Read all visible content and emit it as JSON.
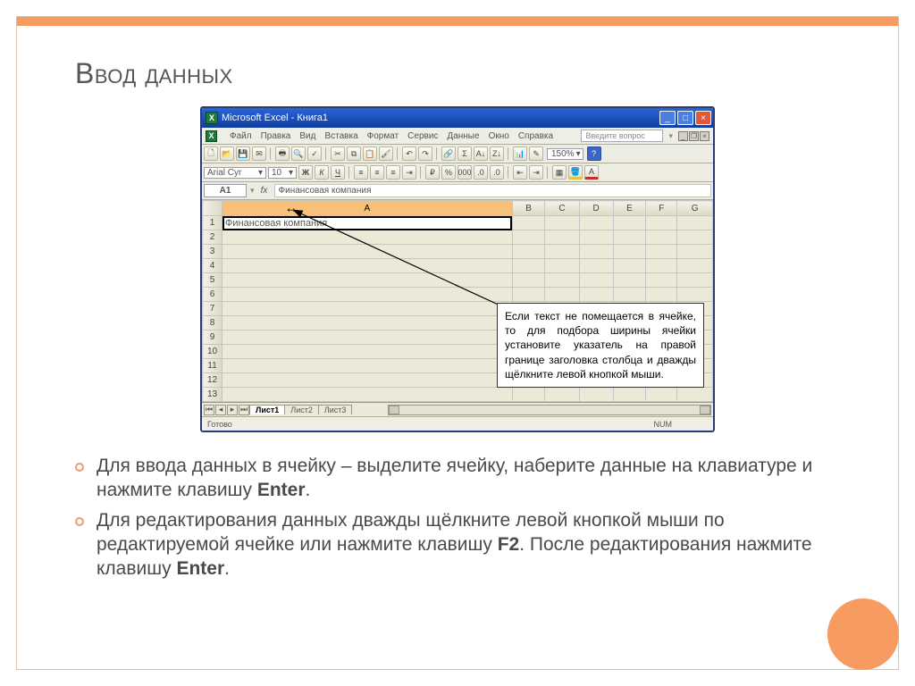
{
  "slide": {
    "title": "Ввод данных",
    "tooltip": "Если текст не помещается в ячейке, то для подбора ширины ячейки установите указатель на правой границе заголовка столбца и дважды щёлкните левой кнопкой мыши.",
    "bullet1_a": "Для ввода данных в ячейку – выделите ячейку, наберите данные на клавиатуре и нажмите клавишу ",
    "bullet1_b": "Enter",
    "bullet1_c": ".",
    "bullet2_a": "Для редактирования данных дважды щёлкните левой кнопкой мыши по редактируемой ячейке или нажмите клавишу ",
    "bullet2_b": "F2",
    "bullet2_c": ". После редактирования нажмите клавишу ",
    "bullet2_d": "Enter",
    "bullet2_e": "."
  },
  "excel": {
    "title": "Microsoft Excel - Книга1",
    "menu": [
      "Файл",
      "Правка",
      "Вид",
      "Вставка",
      "Формат",
      "Сервис",
      "Данные",
      "Окно",
      "Справка"
    ],
    "ask_placeholder": "Введите вопрос",
    "font": "Arial Cyr",
    "font_size": "10",
    "zoom": "150%",
    "cell_ref": "A1",
    "formula": "Финансовая компания",
    "columns": [
      "A",
      "B",
      "C",
      "D",
      "E",
      "F",
      "G"
    ],
    "rows": [
      "1",
      "2",
      "3",
      "4",
      "5",
      "6",
      "7",
      "8",
      "9",
      "10",
      "11",
      "12",
      "13"
    ],
    "cell_A1": "Финансовая компания",
    "tabs": {
      "t1": "Лист1",
      "t2": "Лист2",
      "t3": "Лист3"
    },
    "status": "Готово",
    "num": "NUM"
  }
}
